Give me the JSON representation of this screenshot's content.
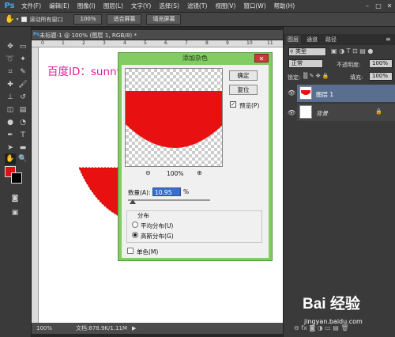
{
  "menubar": {
    "logo": "Ps",
    "items": [
      "文件(F)",
      "编辑(E)",
      "图像(I)",
      "图层(L)",
      "文字(Y)",
      "选择(S)",
      "滤镜(T)",
      "视图(V)",
      "窗口(W)",
      "帮助(H)"
    ],
    "window_controls": [
      "–",
      "□",
      "✕"
    ]
  },
  "options_bar": {
    "scroll_all_label": "滚动所有窗口",
    "zoom_button": "100%",
    "fit_screen_button": "适合屏幕",
    "fill_screen_button": "填充屏幕"
  },
  "toolbox": {
    "foreground_color": "#e01010",
    "background_color": "#000000"
  },
  "document": {
    "tab_label": "未标题-1 @ 100% (图层 1, RGB/8) *",
    "zoom": "100%",
    "doc_info": "文档:878.9K/1.11M",
    "ruler_top_ticks": [
      "0",
      "1",
      "2",
      "3",
      "4",
      "5",
      "6",
      "7",
      "8",
      "9",
      "10",
      "11"
    ]
  },
  "layers_panel": {
    "tabs": [
      "图层",
      "通道",
      "路径"
    ],
    "kind_filter": "类型",
    "blend_mode": "正常",
    "opacity_label": "不透明度:",
    "opacity_value": "100%",
    "lock_label": "锁定:",
    "fill_label": "填充:",
    "fill_value": "100%",
    "layers": [
      {
        "name": "图层 1"
      },
      {
        "name": "背景"
      }
    ]
  },
  "dialog": {
    "title": "添加杂色",
    "ok_button": "确定",
    "reset_button": "复位",
    "preview_label": "预览(P)",
    "preview_checked": true,
    "zoom_value": "100%",
    "amount_label": "数量(A):",
    "amount_value": "10.95",
    "amount_unit": "%",
    "distribution_label": "分布",
    "uniform_label": "平均分布(U)",
    "gaussian_label": "高斯分布(G)",
    "selected_distribution": "gaussian",
    "monochromatic_label": "单色(M)"
  },
  "watermark": {
    "text": "百度ID：sunnyMelody夏",
    "baidu_logo": "Bai 经验",
    "baidu_url": "jingyan.baidu.com"
  }
}
